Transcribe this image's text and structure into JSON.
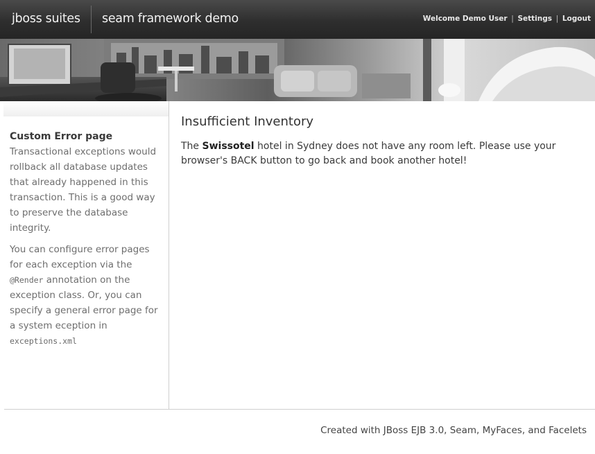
{
  "header": {
    "brand": "jboss suites",
    "subtitle": "seam framework demo",
    "welcome": "Welcome Demo User",
    "separator": "|",
    "settings": "Settings",
    "logout": "Logout"
  },
  "banner": {
    "alt": "hotel room photo banner"
  },
  "sidebar": {
    "title": "Custom Error page",
    "paragraph1": "Transactional exceptions would rollback all database updates that already happened in this transaction. This is a good way to preserve the database integrity.",
    "p2_before": "You can configure error pages for each exception via the ",
    "p2_code1": "@Render",
    "p2_middle": " annotation on the exception class. Or, you can specify a general error page for a system eception in ",
    "p2_code2": "exceptions.xml"
  },
  "main": {
    "heading": "Insufficient Inventory",
    "msg_before": "The ",
    "hotel_name": "Swissotel",
    "msg_after": " hotel in Sydney does not have any room left. Please use your browser's BACK button to go back and book another hotel!"
  },
  "footer": {
    "text": "Created with JBoss EJB 3.0, Seam, MyFaces, and Facelets"
  }
}
